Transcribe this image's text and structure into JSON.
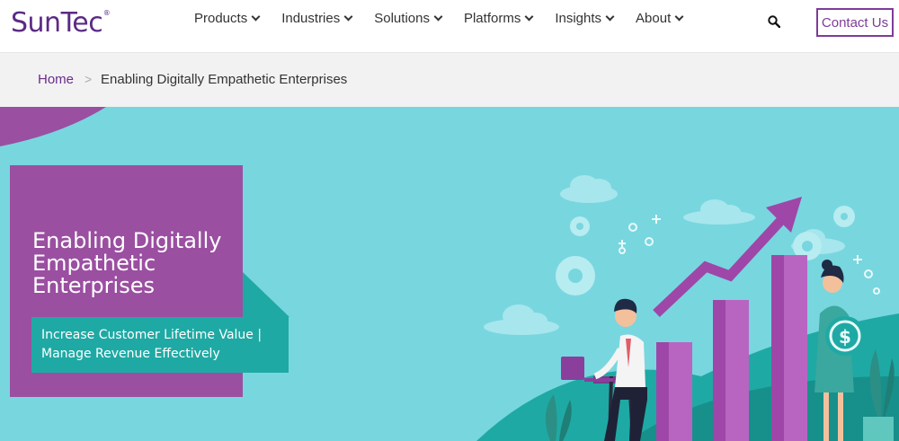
{
  "logo": {
    "text": "SunTec",
    "mark": "®"
  },
  "nav": {
    "items": [
      {
        "label": "Products"
      },
      {
        "label": "Industries"
      },
      {
        "label": "Solutions"
      },
      {
        "label": "Platforms"
      },
      {
        "label": "Insights"
      },
      {
        "label": "About"
      }
    ],
    "contact_label": "Contact Us"
  },
  "breadcrumb": {
    "home": "Home",
    "separator": ">",
    "current": "Enabling Digitally Empathetic Enterprises"
  },
  "hero": {
    "title": "Enabling Digitally Empathetic Enterprises",
    "subtitle_line1": "Increase Customer Lifetime Value |",
    "subtitle_line2": "Manage Revenue Effectively",
    "illustration_icon": "growth-chart-illustration"
  },
  "colors": {
    "brand_purple": "#5b2a86",
    "hero_bg": "#78d6df",
    "card_purple": "#9b4fa1",
    "teal": "#1fa9a4"
  }
}
